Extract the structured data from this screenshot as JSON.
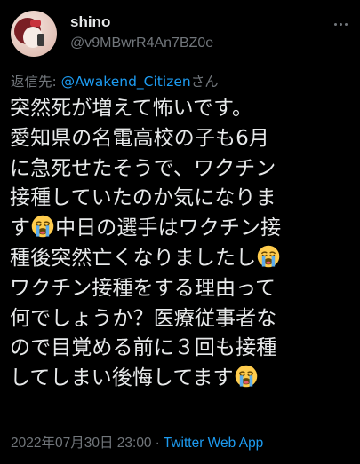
{
  "tweet": {
    "display_name": "shino",
    "handle": "@v9MBwrR4An7BZ0e",
    "reply_prefix": "返信先: ",
    "reply_target": "@Awakend_Citizen",
    "reply_suffix": "さん",
    "body_lines": [
      [
        "突然死が増えて怖いです。"
      ],
      [
        "愛知県の名電高校の子も6月"
      ],
      [
        "に急死せたそうで、ワクチン"
      ],
      [
        "接種していたのか気になりま"
      ],
      [
        "す",
        "crying-face",
        "中日の選手はワクチン接"
      ],
      [
        "種後突然亡くなりましたし",
        "crying-face"
      ],
      [
        "ワクチン接種をする理由って"
      ],
      [
        "何でしょうか？医療従事者な"
      ],
      [
        "ので目覚める前に３回も接種"
      ],
      [
        "してしまい後悔してます",
        "crying-face"
      ]
    ],
    "timestamp": "2022年07月30日 23:00",
    "separator": "·",
    "source": "Twitter Web App"
  },
  "colors": {
    "background": "#000000",
    "text": "#e7e9ea",
    "muted": "#71767b",
    "link": "#1d9bf0"
  },
  "icons": {
    "avatar": "profile-avatar",
    "more": "more-options-icon",
    "emoji": "loudly-crying-face-emoji"
  }
}
